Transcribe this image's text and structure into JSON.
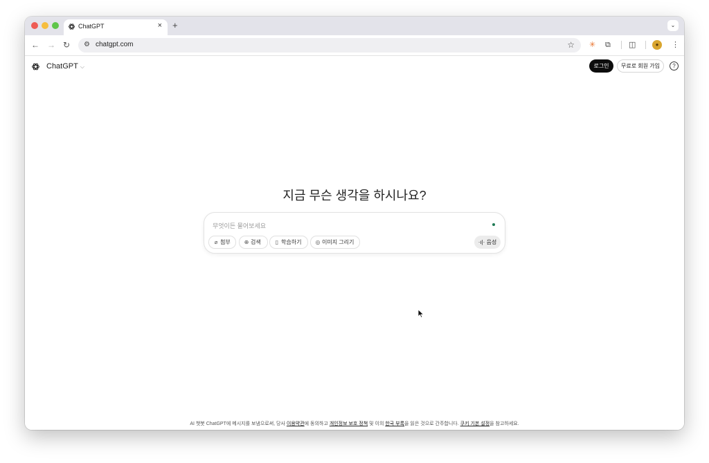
{
  "browser": {
    "tab": {
      "title": "ChatGPT",
      "close_glyph": "×",
      "favicon": "chatgpt-logo-icon"
    },
    "new_tab_glyph": "+",
    "tab_search_glyph": "⌄",
    "nav": {
      "back": "←",
      "forward": "→",
      "reload": "↻"
    },
    "address": {
      "url": "chatgpt.com",
      "site_info_glyph": "⚙",
      "star_glyph": "☆"
    },
    "toolbar_icons": {
      "ext1": "✳",
      "ext2": "⧉",
      "side_panel": "◫",
      "menu": "⋮"
    },
    "profile_glyph": "●"
  },
  "page": {
    "brand": "ChatGPT",
    "brand_chevron": "⌵",
    "login_label": "로그인",
    "signup_label": "무료로 회원 가입",
    "help_glyph": "?",
    "headline": "지금 무슨 생각을 하시나요?",
    "composer": {
      "placeholder": "무엇이든 물어보세요",
      "chips": [
        {
          "label": "첨부",
          "icon": "paperclip-icon",
          "glyph": "⌀"
        },
        {
          "label": "검색",
          "icon": "globe-icon",
          "glyph": "⊕"
        },
        {
          "label": "학습하기",
          "icon": "book-icon",
          "glyph": "▯"
        },
        {
          "label": "이미지 그리기",
          "icon": "image-icon",
          "glyph": "◎"
        }
      ],
      "voice_label": "음성",
      "voice_glyph": "·ı|·"
    },
    "footer": {
      "t1": "AI 챗봇 ChatGPT에 메시지를 보냄으로써, 당사 ",
      "link_terms": "이용약관",
      "t2": "에 동의하고 ",
      "link_privacy": "개인정보 보호 정책",
      "t3": " 및 이의 ",
      "link_korea": "한국 부록",
      "t4": "을 읽은 것으로 간주합니다. ",
      "link_cookies": "쿠키 기본 설정",
      "t5": "을 참고하세요."
    }
  },
  "colors": {
    "tabbar_bg": "#e3e3ea",
    "login_bg": "#0d0d0d",
    "mic_dot": "#1f7a55"
  }
}
